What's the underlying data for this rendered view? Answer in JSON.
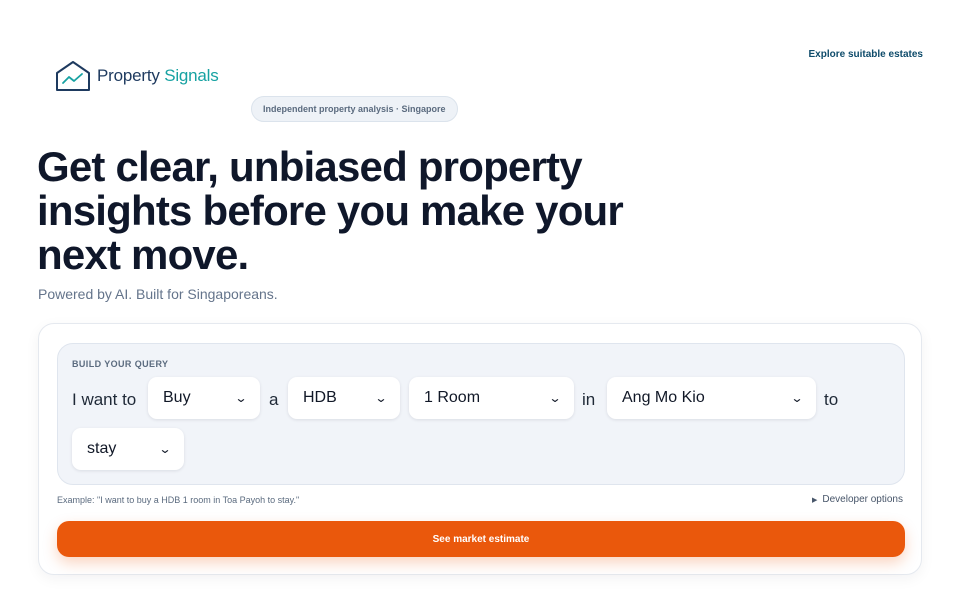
{
  "header": {
    "logo_word_1": "Property",
    "logo_word_2": "Signals",
    "logo_icon": "house-chart-icon",
    "nav_link": "Explore suitable estates"
  },
  "badge": "Independent property analysis · Singapore",
  "hero": {
    "headline": "Get clear, unbiased property insights before you make your next move.",
    "subline": "Powered by AI. Built for Singaporeans."
  },
  "query": {
    "title": "BUILD YOUR QUERY",
    "words": {
      "i_want_to": "I want to",
      "a": "a",
      "in": "in",
      "to": "to"
    },
    "intent": {
      "selected": "Buy"
    },
    "property_type": {
      "selected": "HDB"
    },
    "flat_type": {
      "selected": "1 Room"
    },
    "town": {
      "selected": "Ang Mo Kio"
    },
    "purpose": {
      "selected": "stay"
    }
  },
  "example": "Example: \"I want to buy a HDB 1 room in Toa Payoh to stay.\"",
  "developer_options": "Developer options",
  "cta": "See market estimate",
  "colors": {
    "accent": "#ea580c",
    "brand_navy": "#1e3a5f",
    "brand_teal": "#17a2a2",
    "headline": "#0f172a"
  }
}
